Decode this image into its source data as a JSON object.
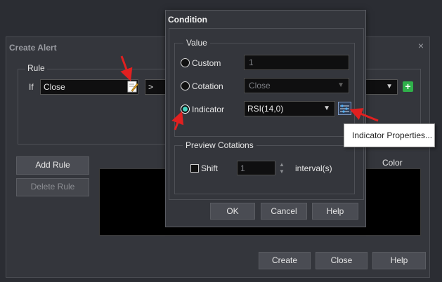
{
  "create_alert": {
    "title": "Create Alert",
    "close_glyph": "×",
    "rule_group_label": "Rule",
    "if_label": "If",
    "left_field_value": "Close",
    "operator_value": ">",
    "add_rule_label": "Add Rule",
    "delete_rule_label": "Delete Rule",
    "color_label": "Color",
    "create_label": "Create",
    "close_label": "Close",
    "help_label": "Help"
  },
  "condition": {
    "title": "Condition",
    "value_group_label": "Value",
    "custom_label": "Custom",
    "custom_value": "1",
    "cotation_label": "Cotation",
    "cotation_value": "Close",
    "indicator_label": "Indicator",
    "indicator_value": "RSI(14,0)",
    "selected_option": "Indicator",
    "preview_group_label": "Preview Cotations",
    "shift_label": "Shift",
    "shift_checked": false,
    "shift_value": "1",
    "interval_label": "interval(s)",
    "ok_label": "OK",
    "cancel_label": "Cancel",
    "help_label": "Help"
  },
  "tooltip": {
    "text": "Indicator Properties..."
  },
  "icons": {
    "edit": "edit-note-icon",
    "add": "plus-icon",
    "properties": "indicator-properties-icon",
    "dropdown": "chevron-down-icon",
    "spin_up": "chevron-up-icon",
    "spin_down": "chevron-down-icon"
  },
  "colors": {
    "background": "#2b2d33",
    "panel": "#34363c",
    "field": "#0f0f10",
    "accent_radio": "#46d3c0",
    "add_button": "#2fb04a",
    "annotation_arrow": "#e02020"
  }
}
